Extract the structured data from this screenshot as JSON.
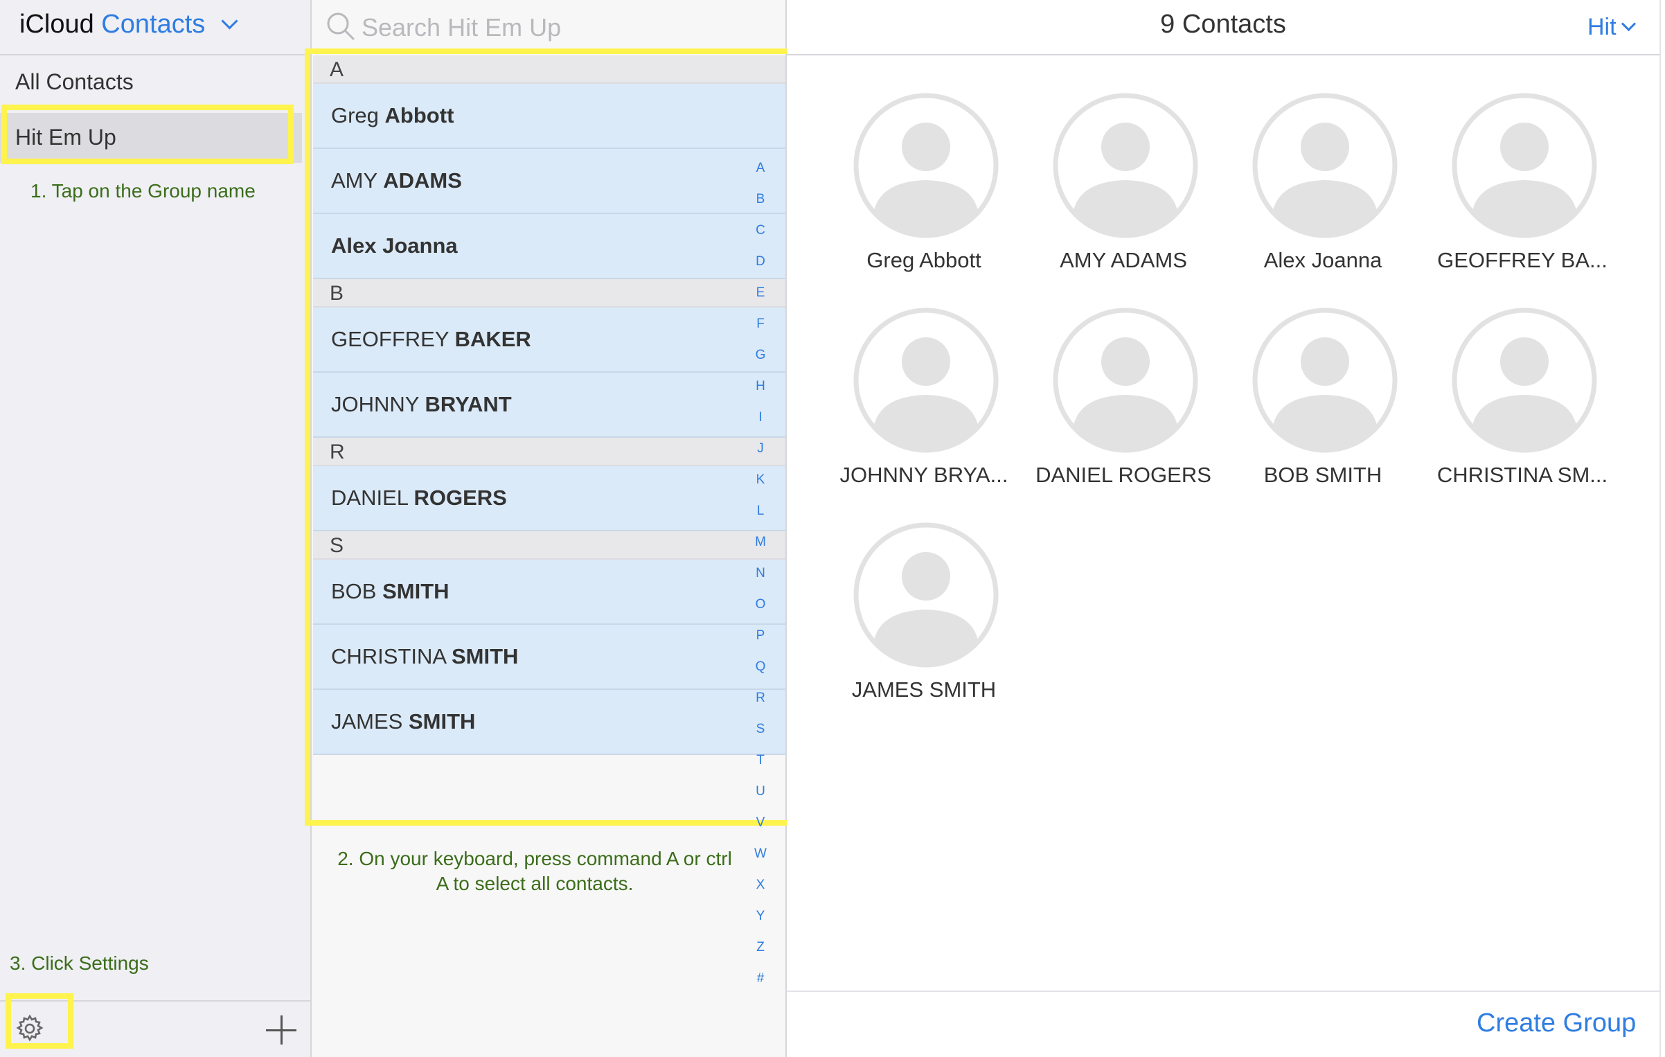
{
  "header": {
    "app_name": "iCloud",
    "app_section": "Contacts",
    "contact_count": "9 Contacts",
    "group_switch": "Hit"
  },
  "sidebar": {
    "items": [
      {
        "label": "All Contacts"
      },
      {
        "label": "Hit Em Up"
      }
    ],
    "note1": "1. Tap on the Group name",
    "note3": "3. Click Settings"
  },
  "search": {
    "placeholder": "Search Hit Em Up"
  },
  "list": {
    "sections": [
      {
        "letter": "A",
        "rows": [
          {
            "first": "Greg",
            "last": "Abbott"
          },
          {
            "first": "AMY",
            "last": "ADAMS"
          },
          {
            "first": "",
            "last": "Alex Joanna"
          }
        ]
      },
      {
        "letter": "B",
        "rows": [
          {
            "first": "GEOFFREY",
            "last": "BAKER"
          },
          {
            "first": "JOHNNY",
            "last": "BRYANT"
          }
        ]
      },
      {
        "letter": "R",
        "rows": [
          {
            "first": "DANIEL",
            "last": "ROGERS"
          }
        ]
      },
      {
        "letter": "S",
        "rows": [
          {
            "first": "BOB",
            "last": "SMITH"
          },
          {
            "first": "CHRISTINA",
            "last": "SMITH"
          },
          {
            "first": "JAMES",
            "last": "SMITH"
          }
        ]
      }
    ],
    "alphabet": [
      "A",
      "B",
      "C",
      "D",
      "E",
      "F",
      "G",
      "H",
      "I",
      "J",
      "K",
      "L",
      "M",
      "N",
      "O",
      "P",
      "Q",
      "R",
      "S",
      "T",
      "U",
      "V",
      "W",
      "X",
      "Y",
      "Z",
      "#"
    ],
    "note2": "2. On your keyboard, press command A or ctrl A to select all contacts."
  },
  "cards": [
    "Greg Abbott",
    "AMY ADAMS",
    "Alex Joanna",
    "GEOFFREY BA...",
    "JOHNNY BRYA...",
    "DANIEL ROGERS",
    "BOB SMITH",
    "CHRISTINA SM...",
    "JAMES SMITH"
  ],
  "footer": {
    "create_group": "Create Group"
  },
  "colors": {
    "accent": "#2f7de1",
    "highlight": "#fff34d",
    "note_text": "#3b6d1a",
    "row_selected": "#dbeaf8"
  },
  "icons": {
    "settings": "gear-icon",
    "add": "plus-icon",
    "search": "search-icon",
    "avatar": "person-placeholder-icon"
  }
}
